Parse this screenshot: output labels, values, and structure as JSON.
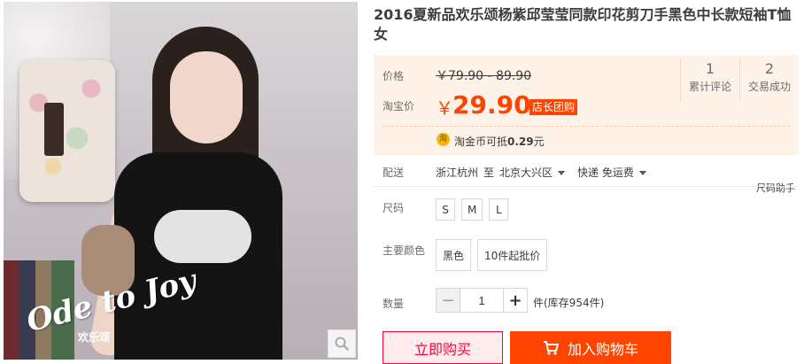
{
  "product": {
    "title": "2016夏新品欢乐颂杨紫邱莹莹同款印花剪刀手黑色中长款短袖T恤女"
  },
  "photo": {
    "watermark": "Ode to Joy",
    "watermark_sub": "欢乐颂",
    "zoom_icon": "magnifier-icon"
  },
  "price": {
    "label": "价格",
    "original": "￥79.90 - 89.90",
    "taobao_label": "淘宝价",
    "currency": "￥",
    "current": "29.90",
    "badge": "店长团购",
    "coin_icon_text": "淘",
    "coin_text_prefix": "淘金币可抵",
    "coin_amount": "0.29",
    "coin_text_suffix": "元"
  },
  "stats": [
    {
      "num": "1",
      "label": "累计评论"
    },
    {
      "num": "2",
      "label": "交易成功"
    }
  ],
  "delivery": {
    "label": "配送",
    "from": "浙江杭州",
    "to_word": "至",
    "to": "北京大兴区",
    "method": "快递 免运费"
  },
  "size_help": "尺码助手",
  "size": {
    "label": "尺码",
    "options": [
      "S",
      "M",
      "L"
    ]
  },
  "color": {
    "label": "主要颜色",
    "options": [
      "黑色",
      "10件起批价"
    ]
  },
  "quantity": {
    "label": "数量",
    "value": "1",
    "minus": "−",
    "plus": "+",
    "stock": "件(库存954件)"
  },
  "actions": {
    "buy_now": "立即购买",
    "add_to_cart": "加入购物车"
  },
  "colors": {
    "accent": "#ff4400",
    "buy_border": "#ff0036",
    "price_panel_bg": "#fff2e8"
  }
}
